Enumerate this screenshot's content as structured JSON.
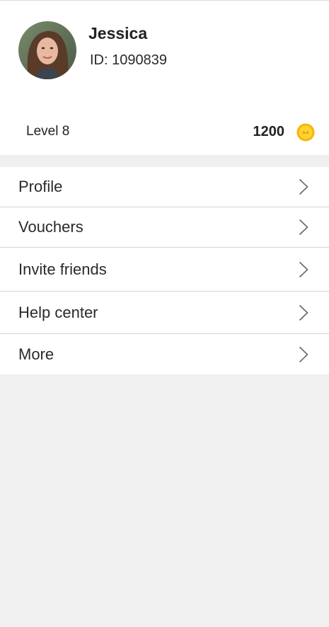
{
  "profile": {
    "name": "Jessica",
    "id_text": "ID: 1090839",
    "level_text": "Level 8",
    "coins": "1200"
  },
  "icons": {
    "avatar": "avatar-photo",
    "coin": "coin-icon",
    "chevron": "chevron-right-icon"
  },
  "colors": {
    "background": "#f0f0f0",
    "card": "#ffffff",
    "divider": "#d6d6d6",
    "coin": "#f5b800"
  },
  "menu": {
    "items": [
      {
        "label": "Profile"
      },
      {
        "label": "Vouchers"
      },
      {
        "label": "Invite friends"
      },
      {
        "label": "Help center"
      },
      {
        "label": "More"
      }
    ]
  }
}
